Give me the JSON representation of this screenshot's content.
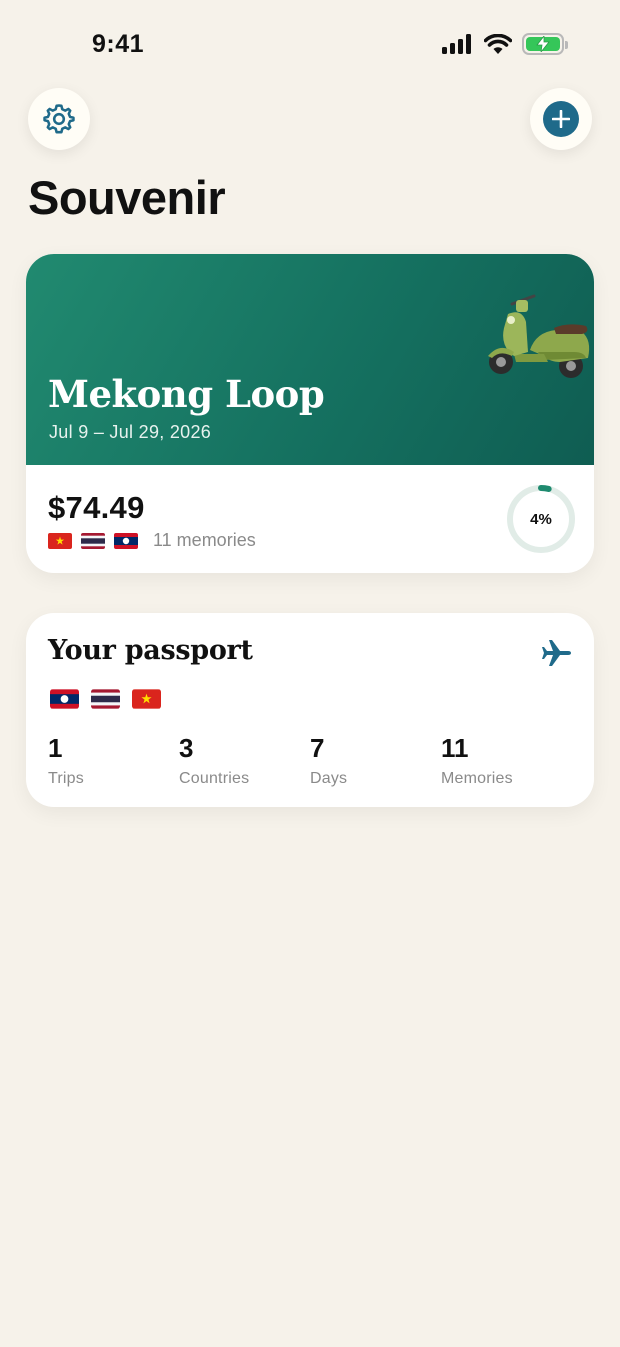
{
  "status_bar": {
    "time": "9:41"
  },
  "app": {
    "title": "Souvenir"
  },
  "icons": {
    "settings": "gear-icon",
    "add": "plus-icon",
    "plane": "airplane-icon"
  },
  "trip_card": {
    "name": "Mekong Loop",
    "dates": "Jul 9 – Jul 29, 2026",
    "amount": "$74.49",
    "flags": [
      "Vietnam",
      "Thailand",
      "Laos"
    ],
    "memories": "11 memories",
    "progress_label": "4%",
    "progress_fraction": 0.04,
    "hero_image": "scooter"
  },
  "passport": {
    "title": "Your passport",
    "flags": [
      "Laos",
      "Thailand",
      "Vietnam"
    ],
    "stats": [
      {
        "value": "1",
        "label": "Trips"
      },
      {
        "value": "3",
        "label": "Countries"
      },
      {
        "value": "7",
        "label": "Days"
      },
      {
        "value": "11",
        "label": "Memories"
      }
    ]
  },
  "colors": {
    "background": "#f6f2ea",
    "accent": "#1f6a8a",
    "hero_green": "#157160",
    "progress": "#1e8a6f",
    "progress_track": "#e1ece7"
  }
}
